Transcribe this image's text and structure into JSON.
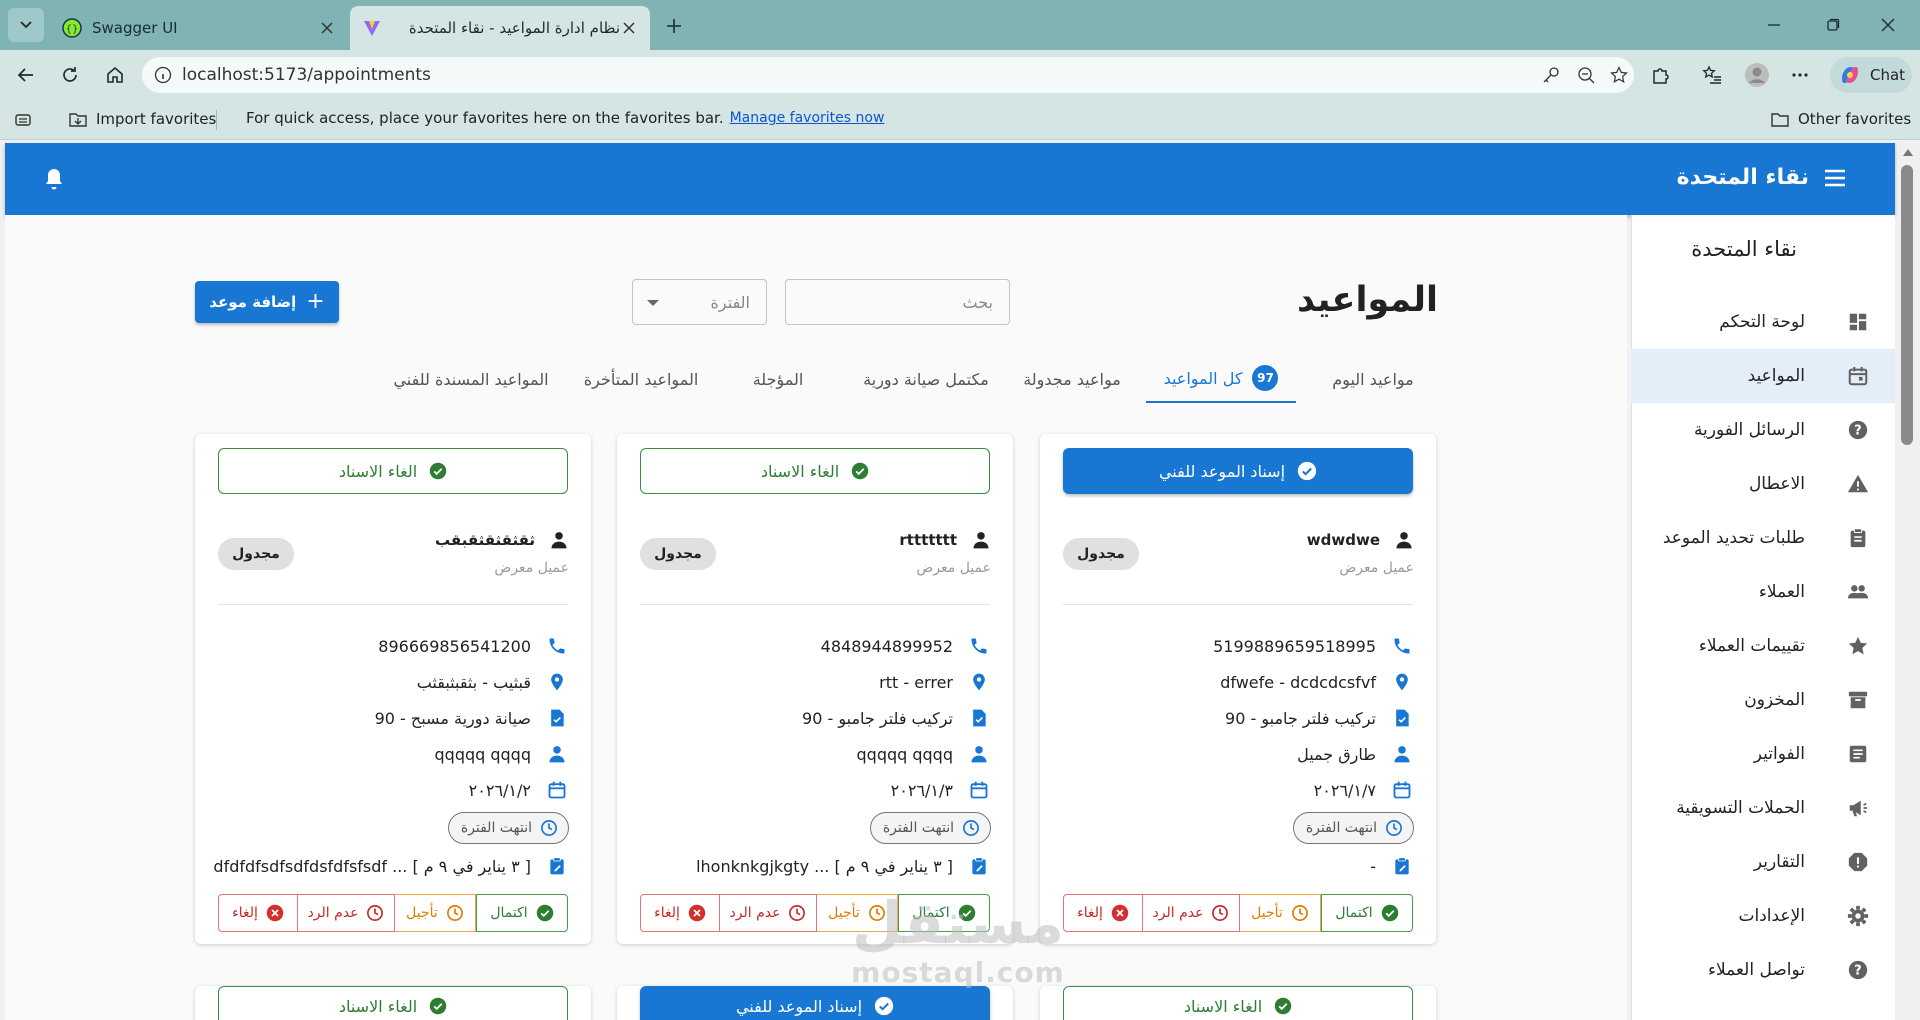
{
  "browser": {
    "tabs": [
      {
        "title": "Swagger UI",
        "active": false
      },
      {
        "title": "نظام ادارة المواعيد - نقاء المتحدة",
        "active": true
      }
    ],
    "url": "localhost:5173/appointments",
    "chat_label": "Chat",
    "favorites_bar": {
      "import_label": "Import favorites",
      "message": "For quick access, place your favorites here on the favorites bar.",
      "manage_link": "Manage favorites now",
      "other_label": "Other favorites"
    }
  },
  "app": {
    "brand": "نقاء المتحدة",
    "sidebar_title": "نقاء المتحدة",
    "sidebar": [
      {
        "label": "لوحة التحكم",
        "icon": "dashboard-icon",
        "active": false
      },
      {
        "label": "المواعيد",
        "icon": "calendar-icon",
        "active": true
      },
      {
        "label": "الرسائل الفورية",
        "icon": "help-circle-icon",
        "active": false
      },
      {
        "label": "الاعطال",
        "icon": "warning-icon",
        "active": false
      },
      {
        "label": "طلبات تحديد الموعد",
        "icon": "clipboard-icon",
        "active": false
      },
      {
        "label": "العملاء",
        "icon": "people-icon",
        "active": false
      },
      {
        "label": "تقييمات العملاء",
        "icon": "star-icon",
        "active": false
      },
      {
        "label": "المخزون",
        "icon": "archive-icon",
        "active": false
      },
      {
        "label": "الفواتير",
        "icon": "receipt-icon",
        "active": false
      },
      {
        "label": "الحملات التسويقية",
        "icon": "campaign-icon",
        "active": false
      },
      {
        "label": "التقارير",
        "icon": "report-icon",
        "active": false
      },
      {
        "label": "الإعدادات",
        "icon": "gear-icon",
        "active": false
      },
      {
        "label": "تواصل العملاء",
        "icon": "help-circle-icon",
        "active": false
      }
    ]
  },
  "page": {
    "title": "المواعيد",
    "search_placeholder": "بحث",
    "period_placeholder": "الفترة",
    "add_button": "إضافة موعد",
    "tabs": [
      {
        "label": "مواعيد اليوم",
        "selected": false
      },
      {
        "label": "كل المواعيد",
        "selected": true,
        "badge": "97"
      },
      {
        "label": "مواعيد مجدولة",
        "selected": false
      },
      {
        "label": "مكتمل صيانة دورية",
        "selected": false
      },
      {
        "label": "المؤجلة",
        "selected": false
      },
      {
        "label": "المواعيد المتأخرة",
        "selected": false
      },
      {
        "label": "المواعيد المسندة للفني",
        "selected": false
      }
    ]
  },
  "labels": {
    "assign": "إسناد الموعد للفني",
    "unassign": "الغاء الاسناد",
    "customer_type": "عميل معرض",
    "period_ended": "انتهت الفترة",
    "complete": "اكتمال",
    "postpone": "تأجيل",
    "no_response": "عدم الرد",
    "cancel": "إلغاء"
  },
  "cards": [
    {
      "top_action": "assign",
      "customer": "wdwdwe",
      "status": "مجدول",
      "phone": "5199889659518995",
      "location": "dfwefe - dcdcdcsfvf",
      "service": "تركيب فلتر جامبو - 90",
      "technician": "طارق جميل",
      "date": "٢٠٢٦/١/٧",
      "notes": "-"
    },
    {
      "top_action": "unassign",
      "customer": "rttttttt",
      "status": "مجدول",
      "phone": "4848944899952",
      "location": "rtt - errer",
      "service": "تركيب فلتر جامبو - 90",
      "technician": "qqqqq qqqq",
      "date": "٢٠٢٦/١/٣",
      "notes": "[ ٣ يناير في ٩ م ] ... lhonknkgjkgty"
    },
    {
      "top_action": "unassign",
      "customer": "ثقثقثقثقبقب",
      "status": "مجدول",
      "phone": "896669856541200",
      "location": "قبثيب - بثقبثبقثب",
      "service": "صيانة دورية مسبح - 90",
      "technician": "qqqqq qqqq",
      "date": "٢٠٢٦/١/٢",
      "notes": "[ ٣ يناير في ٩ م ] ... dfdfdfsdfsdfdsfdfsfsdf"
    }
  ],
  "second_row": [
    {
      "top_action": "unassign"
    },
    {
      "top_action": "assign"
    },
    {
      "top_action": "unassign"
    }
  ],
  "watermark": {
    "arabic": "مستقل",
    "latin": "mostaql.com"
  }
}
